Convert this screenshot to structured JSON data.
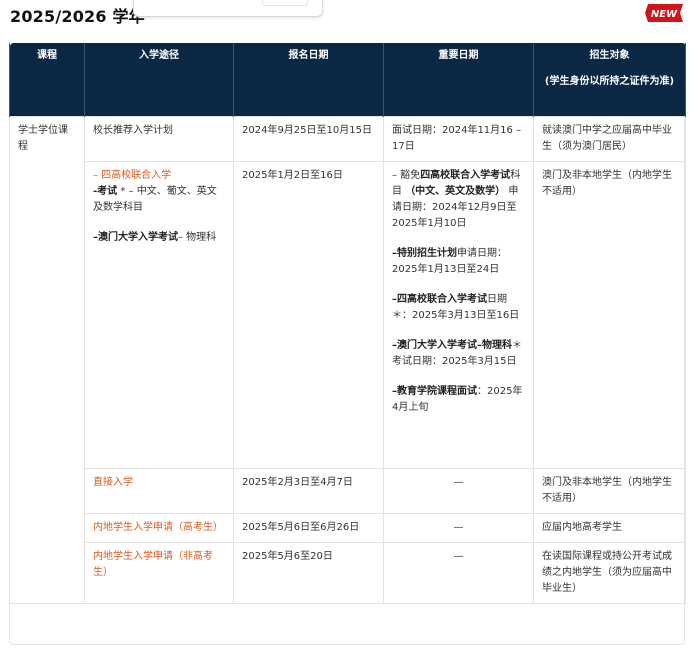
{
  "page": {
    "year_title": "2025/2026 学年"
  },
  "badge": {
    "label": "NEW"
  },
  "table": {
    "headers": {
      "course": "课程",
      "route": "入学途径",
      "reg_date": "报名日期",
      "important": "重要日期",
      "target": "招生对象",
      "target_note": "(学生身份以所持之证件为准)"
    },
    "course_name": "学士学位课程",
    "row1": {
      "route": "校长推荐入学计划",
      "reg_date": "2024年9月25日至10月15日",
      "important": "面试日期：2024年11月16 – 17日",
      "target": "就读澳门中学之应届高中毕业生（须为澳门居民）"
    },
    "row2": {
      "route_link": "– 四高校联合入学",
      "route_exam_label": "-考试",
      "route_exam_rest": " * – 中文、葡文、英文及数学科目",
      "route_um_label": "–澳门大学入学考试",
      "route_um_rest": "– 物理科",
      "reg_date": "2025年1月2日至16日",
      "imp1_a": "– 豁免",
      "imp1_b": "四高校联合入学考试",
      "imp1_c": "科目 ",
      "imp1_d": "（中文、英文及数学）",
      "imp1_e": " 申请日期：2024年12月9日至2025年1月10日",
      "imp2_a": "–特别招生计划",
      "imp2_b": "申请日期：2025年1月13日至24日",
      "imp3_a": "–四高校联合入学考试",
      "imp3_b": "日期＊：2025年3月13日至16日",
      "imp4_a": "–澳门大学入学考试–物理科",
      "imp4_b": "＊考试日期：2025年3月15日",
      "imp5_a": "–教育学院课程面试",
      "imp5_b": "：2025年4月上旬",
      "target": "澳门及非本地学生（内地学生不适用）"
    },
    "row3": {
      "route": "直接入学",
      "reg_date": "2025年2月3日至4月7日",
      "important": "—",
      "target": "澳门及非本地学生（内地学生不适用）"
    },
    "row4": {
      "route": "内地学生入学申请（高考生）",
      "reg_date": "2025年5月6日至6月26日",
      "important": "—",
      "target": "应届内地高考学生"
    },
    "row5": {
      "route": "内地学生入学申请（非高考生）",
      "reg_date": "2025年5月6至20日",
      "important": "—",
      "target": "在读国际课程或持公开考试成绩之内地学生（须为应届高中毕业生）"
    }
  }
}
